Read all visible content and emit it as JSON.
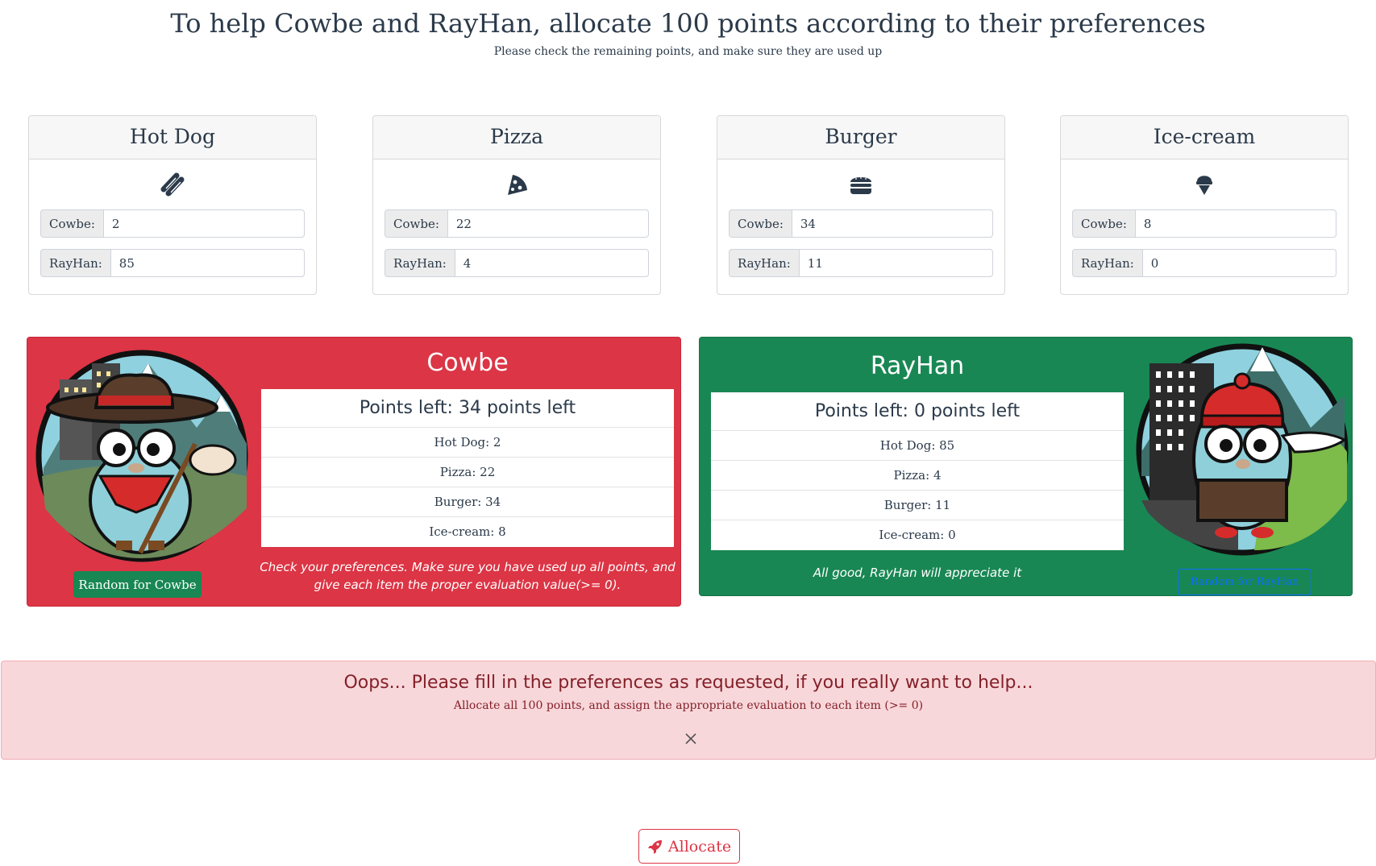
{
  "header": {
    "title": "To help Cowbe and RayHan, allocate 100 points according to their preferences",
    "subtitle": "Please check the remaining points, and make sure they are used up"
  },
  "items": [
    {
      "name": "Hot Dog",
      "icon": "hotdog-icon",
      "cowbe_label": "Cowbe:",
      "cowbe_value": "2",
      "rayhan_label": "RayHan:",
      "rayhan_value": "85"
    },
    {
      "name": "Pizza",
      "icon": "pizza-icon",
      "cowbe_label": "Cowbe:",
      "cowbe_value": "22",
      "rayhan_label": "RayHan:",
      "rayhan_value": "4"
    },
    {
      "name": "Burger",
      "icon": "burger-icon",
      "cowbe_label": "Cowbe:",
      "cowbe_value": "34",
      "rayhan_label": "RayHan:",
      "rayhan_value": "11"
    },
    {
      "name": "Ice-cream",
      "icon": "icecream-icon",
      "cowbe_label": "Cowbe:",
      "cowbe_value": "8",
      "rayhan_label": "RayHan:",
      "rayhan_value": "0"
    }
  ],
  "cowbe": {
    "name": "Cowbe",
    "points_left": "Points left: 34 points left",
    "rows": [
      "Hot Dog: 2",
      "Pizza: 22",
      "Burger: 34",
      "Ice-cream: 8"
    ],
    "note_line1": "Check your preferences. Make sure you have used up all points, and",
    "note_line2": "give each item the proper evaluation value(>= 0).",
    "random_button": "Random for Cowbe",
    "color": "#dc3545"
  },
  "rayhan": {
    "name": "RayHan",
    "points_left": "Points left: 0 points left",
    "rows": [
      "Hot Dog: 85",
      "Pizza: 4",
      "Burger: 11",
      "Ice-cream: 0"
    ],
    "note": "All good, RayHan will appreciate it",
    "random_button": "Random for RayHan",
    "color": "#198754"
  },
  "alert": {
    "title": "Oops... Please fill in the preferences as requested, if you really want to help...",
    "subtitle": "Allocate all 100 points, and assign the appropriate evaluation to each item (>= 0)"
  },
  "allocate_button": "Allocate"
}
